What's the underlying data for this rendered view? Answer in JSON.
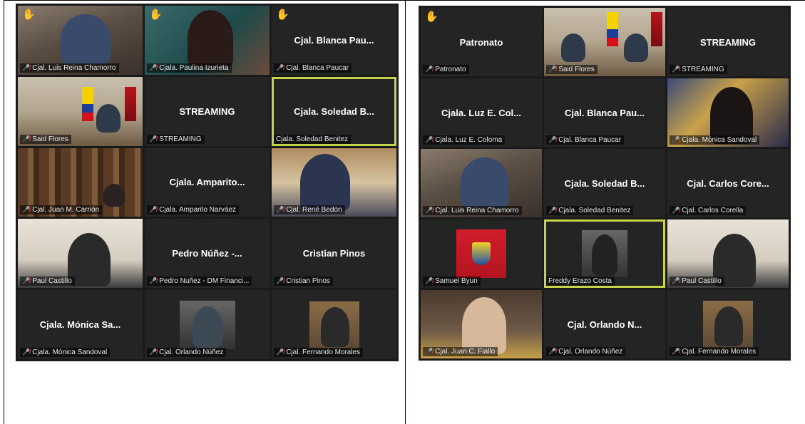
{
  "colors": {
    "tile_bg": "#242424",
    "grid_bg": "#1a1a1a",
    "active_border": "#c6d44a",
    "muted_mic": "#e0443a",
    "raised_hand": "#f2c31b"
  },
  "left_panel": {
    "tiles": [
      {
        "label": "Cjal. Luis Reina Chamorro",
        "muted": true,
        "hand": true,
        "video": true
      },
      {
        "label": "Cjala. Paulina Izurieta",
        "muted": true,
        "hand": true,
        "video": true
      },
      {
        "display_name": "Cjal. Blanca Pau...",
        "label": "Cjal. Blanca Paucar",
        "muted": true,
        "hand": true,
        "video": false
      },
      {
        "label": "Said Flores",
        "muted": true,
        "hand": false,
        "video": true
      },
      {
        "display_name": "STREAMING",
        "label": "STREAMING",
        "muted": true,
        "hand": false,
        "video": false
      },
      {
        "display_name": "Cjala. Soledad B...",
        "label": "Cjala. Soledad Benitez",
        "muted": false,
        "hand": false,
        "video": false,
        "active": true
      },
      {
        "label": "Cjal. Juan M. Carrión",
        "muted": true,
        "hand": false,
        "video": true
      },
      {
        "display_name": "Cjala. Amparito...",
        "label": "Cjala. Amparito Narváez",
        "muted": true,
        "hand": false,
        "video": false
      },
      {
        "label": "Cjal. René Bedón",
        "muted": true,
        "hand": false,
        "video": true
      },
      {
        "label": "Paul Castillo",
        "muted": true,
        "hand": false,
        "video": true
      },
      {
        "display_name": "Pedro Núñez -...",
        "label": "Pedro Nuñez - DM Financi...",
        "muted": true,
        "hand": false,
        "video": false
      },
      {
        "display_name": "Cristian Pinos",
        "label": "Cristian Pinos",
        "muted": true,
        "hand": false,
        "video": false
      },
      {
        "display_name": "Cjala. Mónica Sa...",
        "label": "Cjala. Mónica Sandoval",
        "muted": true,
        "hand": false,
        "video": false
      },
      {
        "label": "Cjal. Orlando Núñez",
        "muted": true,
        "hand": false,
        "video": true
      },
      {
        "label": "Cjal. Fernando Morales",
        "muted": true,
        "hand": false,
        "video": true
      }
    ]
  },
  "right_panel": {
    "tiles": [
      {
        "display_name": "Patronato",
        "label": "Patronato",
        "muted": true,
        "hand": true,
        "video": false
      },
      {
        "label": "Said Flores",
        "muted": true,
        "hand": false,
        "video": true
      },
      {
        "display_name": "STREAMING",
        "label": "STREAMING",
        "muted": true,
        "hand": false,
        "video": false
      },
      {
        "display_name": "Cjala. Luz E. Col...",
        "label": "Cjala. Luz E. Coloma",
        "muted": true,
        "hand": false,
        "video": false
      },
      {
        "display_name": "Cjal. Blanca Pau...",
        "label": "Cjal. Blanca Paucar",
        "muted": true,
        "hand": false,
        "video": false
      },
      {
        "label": "Cjala. Mónica Sandoval",
        "muted": true,
        "hand": false,
        "video": true
      },
      {
        "label": "Cjal. Luis Reina Chamorro",
        "muted": true,
        "hand": false,
        "video": true
      },
      {
        "display_name": "Cjala. Soledad B...",
        "label": "Cjala. Soledad Benitez",
        "muted": true,
        "hand": false,
        "video": false
      },
      {
        "display_name": "Cjal. Carlos Core...",
        "label": "Cjal. Carlos Corella",
        "muted": true,
        "hand": false,
        "video": false
      },
      {
        "label": "Samuel Byun",
        "muted": true,
        "hand": false,
        "video": true
      },
      {
        "label": "Freddy Erazo Costa",
        "muted": false,
        "hand": false,
        "video": true,
        "active": true
      },
      {
        "label": "Paul Castillo",
        "muted": true,
        "hand": false,
        "video": true
      },
      {
        "label": "Cjal. Juan C. Fiallo",
        "muted": true,
        "hand": false,
        "video": true
      },
      {
        "display_name": "Cjal. Orlando N...",
        "label": "Cjal. Orlando Núñez",
        "muted": true,
        "hand": false,
        "video": false
      },
      {
        "label": "Cjal. Fernando Morales",
        "muted": true,
        "hand": false,
        "video": true
      }
    ]
  }
}
